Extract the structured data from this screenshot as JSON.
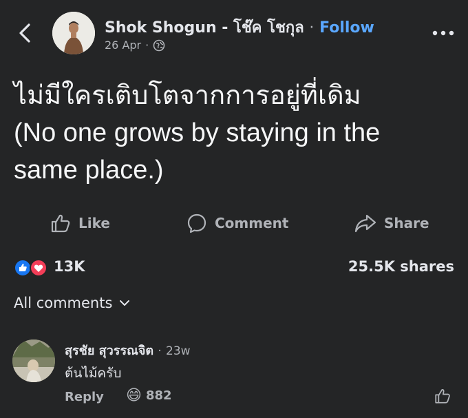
{
  "header": {
    "author": "Shok Shogun - โช๊ค โชกุล",
    "separator": "·",
    "follow_label": "Follow",
    "date": "26 Apr",
    "date_separator": "·"
  },
  "post": {
    "lines": [
      "ไม่มีใครเติบโตจากการอยู่ที่เดิม",
      "(No one grows by staying in the",
      "same place.)"
    ]
  },
  "actions": {
    "like_label": "Like",
    "comment_label": "Comment",
    "share_label": "Share"
  },
  "stats": {
    "reaction_count": "13K",
    "shares": "25.5K shares"
  },
  "comments": {
    "filter_label": "All comments",
    "items": [
      {
        "name": "สุรชัย สุวรรณจิต",
        "separator": "·",
        "time": "23w",
        "text": "ต้นไม้ครับ",
        "reply_label": "Reply",
        "reaction_emoji": "😄",
        "reaction_count": "882"
      }
    ]
  },
  "icons": {
    "back": "chevron-left-icon",
    "globe": "globe-icon",
    "more": "more-dots-icon",
    "like": "thumbs-up-icon",
    "comment": "comment-bubble-icon",
    "share": "share-arrow-icon",
    "reaction_like": "like-reaction-icon",
    "reaction_love": "love-reaction-icon",
    "chevron_down": "chevron-down-icon"
  },
  "colors": {
    "background": "#242526",
    "follow_link": "#5aa7ff",
    "like_blue": "#1877f2",
    "love_red": "#f33e58",
    "secondary_text": "#b0b3b8"
  }
}
